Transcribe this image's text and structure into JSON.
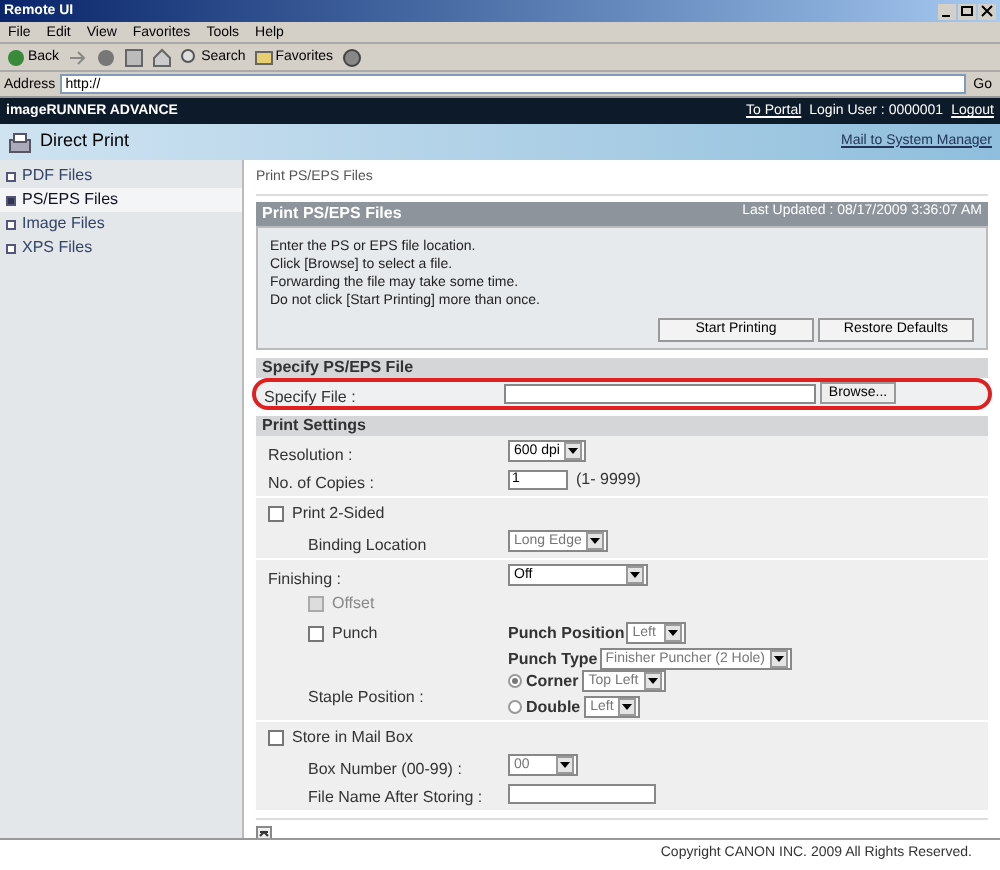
{
  "window": {
    "title": "Remote UI"
  },
  "menu": [
    "File",
    "Edit",
    "View",
    "Favorites",
    "Tools",
    "Help"
  ],
  "toolbar": [
    {
      "kind": "back",
      "label": "Back"
    },
    {
      "kind": "forward"
    },
    {
      "kind": "stop"
    },
    {
      "kind": "refresh"
    },
    {
      "kind": "home"
    },
    {
      "kind": "search",
      "label": "Search"
    },
    {
      "kind": "favorites",
      "label": "Favorites"
    },
    {
      "kind": "media"
    }
  ],
  "address": {
    "label": "Address",
    "value": "http://",
    "go": "Go"
  },
  "header": {
    "brand": "imageRUNNER ADVANCE",
    "portal": "To Portal",
    "user": "Login User : 0000001",
    "logout": "Logout"
  },
  "banner": {
    "title": "Direct Print",
    "mail": "Mail to System Manager"
  },
  "sidebar": {
    "items": [
      {
        "label": "PDF Files",
        "selected": false
      },
      {
        "label": "PS/EPS Files",
        "selected": true
      },
      {
        "label": "Image Files",
        "selected": false
      },
      {
        "label": "XPS Files",
        "selected": false
      }
    ]
  },
  "content": {
    "breadcrumb": "Print PS/EPS Files",
    "title": "Print PS/EPS Files",
    "updated": "Last Updated : 08/17/2009 3:36:07 AM",
    "instructions": [
      "Enter the PS or EPS file location.",
      "Click [Browse] to select a file.",
      "Forwarding the file may take some time.",
      "Do not click [Start Printing] more than once."
    ],
    "buttons": [
      "Start Printing",
      "Restore Defaults"
    ]
  },
  "specify": {
    "title": "Specify PS/EPS File",
    "label": "Specify File :",
    "browse": "Browse...",
    "highlighted": true
  },
  "settings": {
    "title": "Print Settings",
    "groups": [
      {
        "rows": [
          {
            "kind": "select",
            "label": "Resolution :",
            "value": "600 dpi",
            "disabled": false
          },
          {
            "kind": "number",
            "label": "No. of Copies :",
            "value": "1",
            "hint": "(1- 9999)"
          }
        ]
      },
      {
        "rows": [
          {
            "kind": "checkbox",
            "label": "Print 2-Sided",
            "checked": false,
            "disabled": false,
            "children": [
              {
                "kind": "select",
                "label": "Binding Location",
                "value": "Long Edge",
                "disabled": true
              }
            ]
          }
        ]
      },
      {
        "rows": [
          {
            "kind": "select",
            "label": "Finishing :",
            "value": "Off",
            "disabled": false,
            "wide": true,
            "children": [
              {
                "kind": "checkbox",
                "label": "Offset",
                "checked": false,
                "disabled": true
              },
              {
                "kind": "punch",
                "label": "Punch",
                "checked": false,
                "disabled": false,
                "position_label": "Punch Position",
                "position": "Left",
                "type_label": "Punch Type",
                "type": "Finisher Puncher (2 Hole)"
              },
              {
                "kind": "staple",
                "label": "Staple Position :",
                "options": [
                  {
                    "label": "Corner",
                    "value": "Top Left",
                    "selected": true
                  },
                  {
                    "label": "Double",
                    "value": "Left",
                    "selected": false
                  }
                ]
              }
            ]
          }
        ]
      },
      {
        "rows": [
          {
            "kind": "checkbox",
            "label": "Store in Mail Box",
            "checked": false,
            "disabled": false,
            "children": [
              {
                "kind": "select",
                "label": "Box Number (00-99) :",
                "value": "00",
                "disabled": true
              },
              {
                "kind": "text",
                "label": "File Name After Storing :"
              }
            ]
          }
        ]
      }
    ]
  },
  "footer": "Copyright CANON INC. 2009 All Rights Reserved."
}
